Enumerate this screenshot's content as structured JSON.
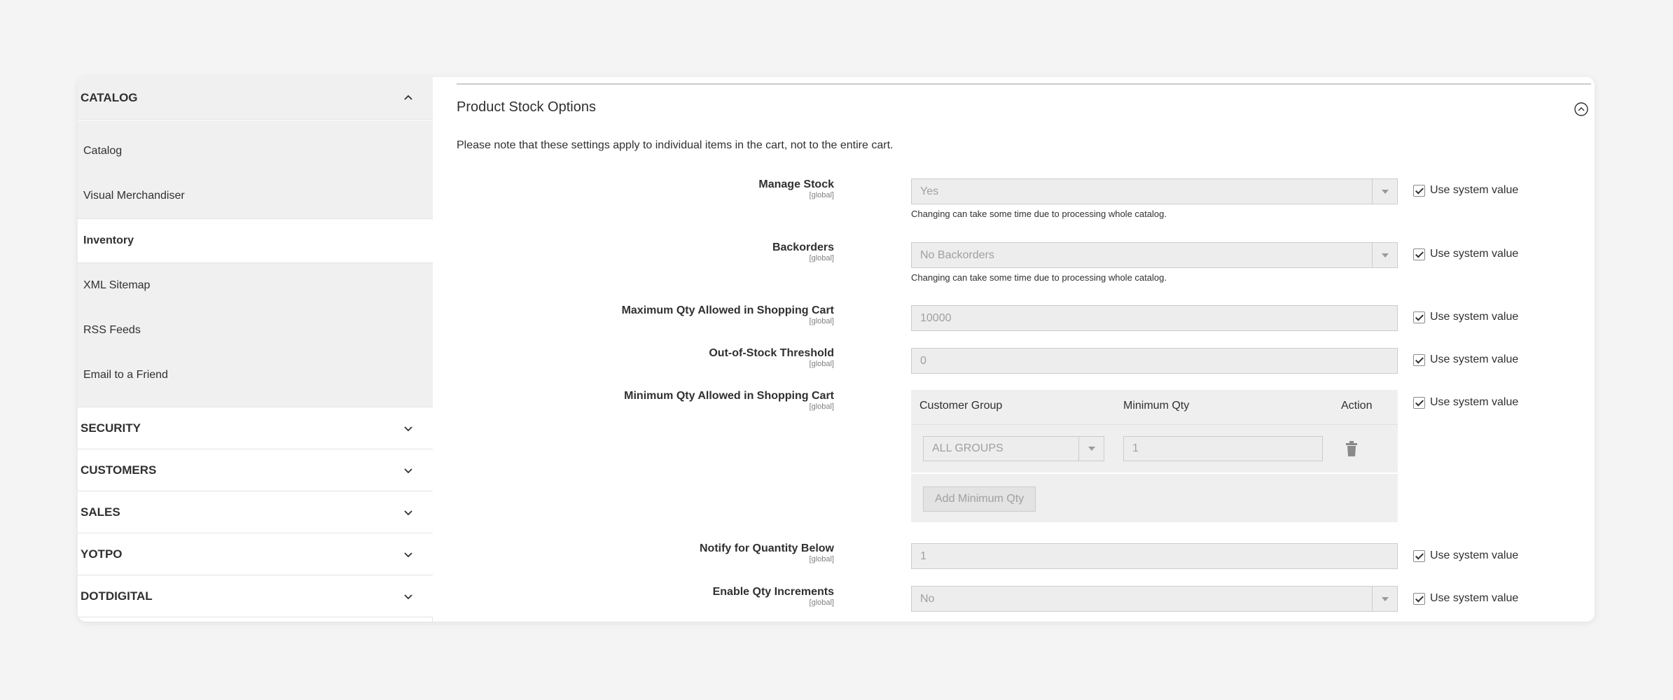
{
  "sidebar": {
    "catalog_section": {
      "label": "CATALOG"
    },
    "items": [
      {
        "label": "Catalog"
      },
      {
        "label": "Visual Merchandiser"
      },
      {
        "label": "Inventory"
      },
      {
        "label": "XML Sitemap"
      },
      {
        "label": "RSS Feeds"
      },
      {
        "label": "Email to a Friend"
      }
    ],
    "sections": [
      {
        "label": "SECURITY"
      },
      {
        "label": "CUSTOMERS"
      },
      {
        "label": "SALES"
      },
      {
        "label": "YOTPO"
      },
      {
        "label": "DOTDIGITAL"
      }
    ]
  },
  "main": {
    "title": "Product Stock Options",
    "note": "Please note that these settings apply to individual items in the cart, not to the entire cart.",
    "scope": "[global]",
    "use_system_value": "Use system value",
    "fields": {
      "manage_stock": {
        "label": "Manage Stock",
        "value": "Yes",
        "hint": "Changing can take some time due to processing whole catalog."
      },
      "backorders": {
        "label": "Backorders",
        "value": "No Backorders",
        "hint": "Changing can take some time due to processing whole catalog."
      },
      "max_qty": {
        "label": "Maximum Qty Allowed in Shopping Cart",
        "value": "10000"
      },
      "oos_threshold": {
        "label": "Out-of-Stock Threshold",
        "value": "0"
      },
      "min_qty": {
        "label": "Minimum Qty Allowed in Shopping Cart",
        "columns": {
          "group": "Customer Group",
          "qty": "Minimum Qty",
          "action": "Action"
        },
        "row": {
          "group": "ALL GROUPS",
          "qty": "1"
        },
        "add_button": "Add Minimum Qty"
      },
      "notify_below": {
        "label": "Notify for Quantity Below",
        "value": "1"
      },
      "qty_increments": {
        "label": "Enable Qty Increments",
        "value": "No"
      }
    }
  }
}
